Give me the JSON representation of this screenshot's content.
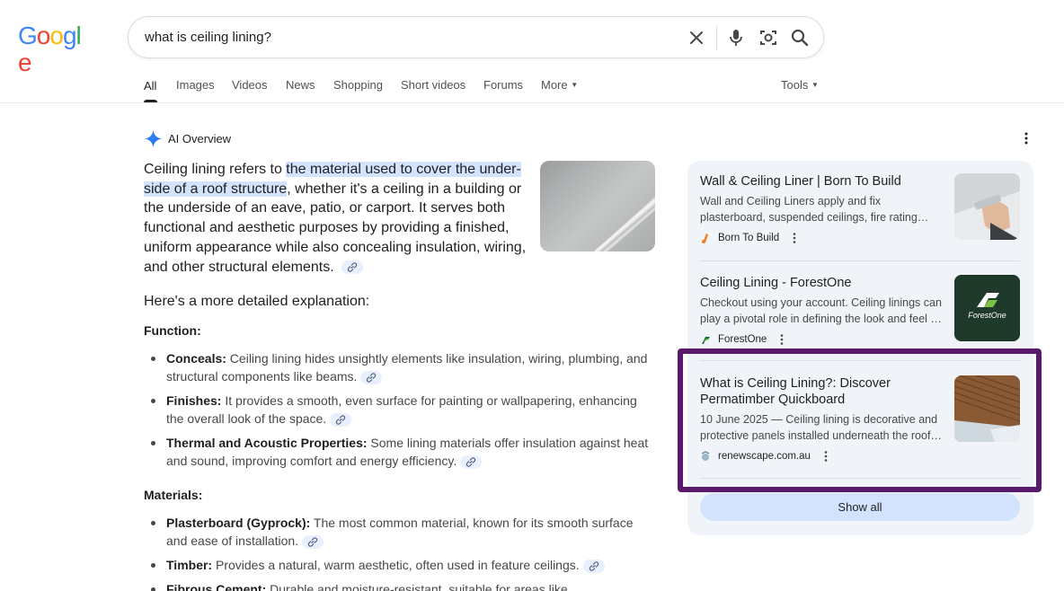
{
  "logo": {
    "letters": [
      "G",
      "o",
      "o",
      "g",
      "l",
      "e"
    ],
    "colors": [
      "#4285f4",
      "#ea4335",
      "#fbbc05",
      "#4285f4",
      "#34a853",
      "#ea4335"
    ]
  },
  "search": {
    "query": "what is ceiling lining?"
  },
  "icons": {
    "clear": "close-icon",
    "voice": "microphone-icon",
    "lens": "camera-lens-icon",
    "search": "search-icon"
  },
  "tabs": [
    {
      "label": "All",
      "active": true
    },
    {
      "label": "Images"
    },
    {
      "label": "Videos"
    },
    {
      "label": "News"
    },
    {
      "label": "Shopping"
    },
    {
      "label": "Short videos"
    },
    {
      "label": "Forums"
    },
    {
      "label": "More"
    }
  ],
  "tools_label": "Tools",
  "ai_overview": {
    "title": "AI Overview",
    "intro_before": "Ceiling lining refers to ",
    "intro_highlight": "the material used to cover the under-side of a roof structure",
    "intro_after": ", whether it's a ceiling in a building or the underside of an eave, patio, or carport. It serves both functional and aesthetic purposes by providing a finished, uniform appearance while also concealing insulation, wiring, and other structural elements.",
    "detail_heading": "Here's a more detailed explanation:",
    "function_heading": "Function:",
    "function_items": [
      {
        "term": "Conceals:",
        "text": " Ceiling lining hides unsightly elements like insulation, wiring, plumbing, and structural components like beams."
      },
      {
        "term": "Finishes:",
        "text": " It provides a smooth, even surface for painting or wallpapering, enhancing the overall look of the space."
      },
      {
        "term": "Thermal and Acoustic Properties:",
        "text": " Some lining materials offer insulation against heat and sound, improving comfort and energy efficiency."
      }
    ],
    "materials_heading": "Materials:",
    "materials_items": [
      {
        "term": "Plasterboard (Gyprock):",
        "text": " The most common material, known for its smooth surface and ease of installation."
      },
      {
        "term": "Timber:",
        "text": " Provides a natural, warm aesthetic, often used in feature ceilings."
      },
      {
        "term": "Fibrous Cement:",
        "text": " Durable and moisture-resistant, suitable for areas like"
      }
    ]
  },
  "sources": [
    {
      "title": "Wall & Ceiling Liner | Born To Build",
      "snippet": "Wall and Ceiling Liners apply and fix plasterboard, suspended ceilings, fire rating…",
      "site": "Born To Build",
      "favicon_color": "#f47b20"
    },
    {
      "title": "Ceiling Lining - ForestOne",
      "snippet": "Checkout using your account. Ceiling linings can play a pivotal role in defining the look and feel …",
      "site": "ForestOne",
      "favicon_color": "#1e6b3a",
      "image_text": "ForestOne"
    },
    {
      "title": "What is Ceiling Lining?: Discover Permatimber Quickboard",
      "snippet": "10 June 2025 — Ceiling lining is decorative and protective panels installed underneath the roof…",
      "site": "renewscape.com.au",
      "favicon_color": "#6b8fa8"
    }
  ],
  "show_all_label": "Show all"
}
